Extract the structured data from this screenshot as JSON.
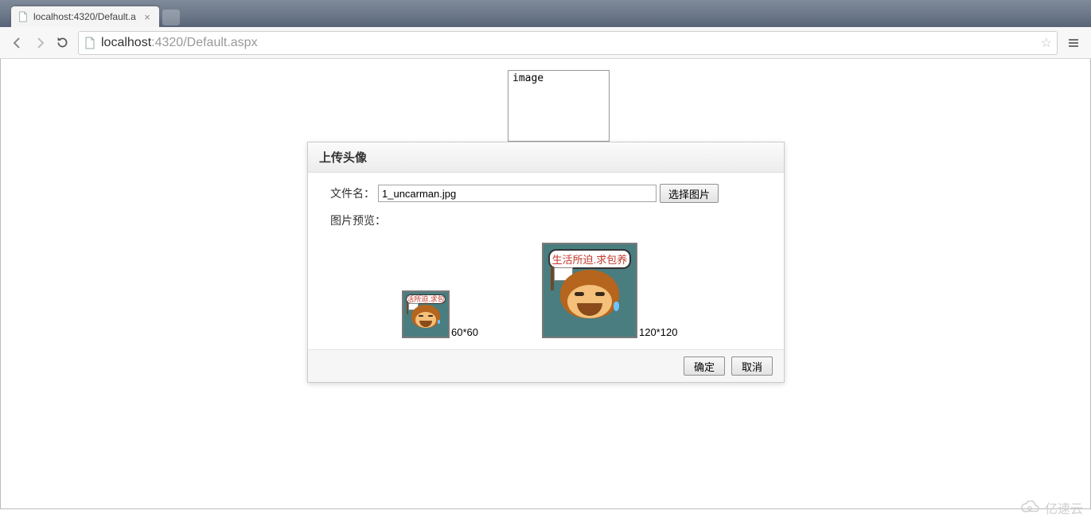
{
  "window": {
    "controls": {
      "min": "—",
      "max": "□",
      "close": "✕"
    }
  },
  "browser": {
    "tab_title": "localhost:4320/Default.a",
    "url_host": "localhost",
    "url_rest": ":4320/Default.aspx"
  },
  "page": {
    "image_alt": "image"
  },
  "dialog": {
    "title": "上传头像",
    "filename_label": "文件名：",
    "filename_value": "1_uncarman.jpg",
    "choose_button": "选择图片",
    "preview_label": "图片预览：",
    "preview_bubble_text": "生活所迫.求包养",
    "dim_small": "60*60",
    "dim_large": "120*120",
    "ok": "确定",
    "cancel": "取消"
  },
  "watermark": "亿速云"
}
